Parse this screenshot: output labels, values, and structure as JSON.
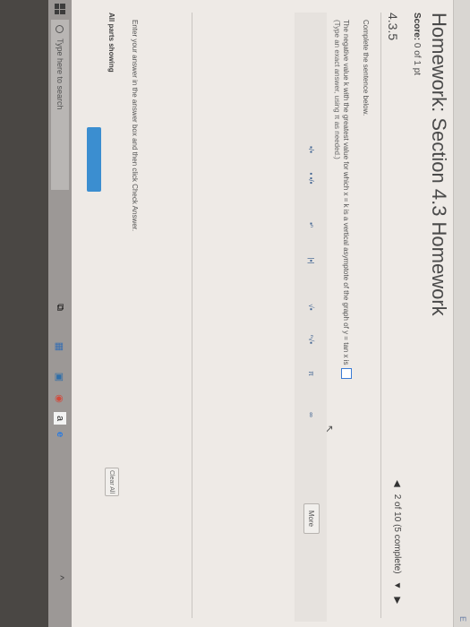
{
  "header": {
    "title": "Homework: Section 4.3 Homework",
    "score_label": "Score:",
    "score_value": "0 of 1 pt",
    "question_number": "4.3.5",
    "nav_status": "2 of 10 (5 complete)"
  },
  "question": {
    "instruction": "Complete the sentence below.",
    "prompt": "The negative value k with the greatest value for which x = k is a vertical asymptote of the graph of y = tan x is",
    "hint": "(Type an exact answer, using π as needed.)"
  },
  "toolbar": {
    "more_label": "More",
    "buttons": [
      "▪/▪",
      "▪ ▪/▪",
      "▪ⁿ",
      "|▪|",
      "√▪",
      "ⁿ√▪",
      "π",
      "∞"
    ]
  },
  "footer": {
    "enter_instruction": "Enter your answer in the answer box and then click Check Answer.",
    "all_parts": "All parts showing",
    "clear_all": "Clear All"
  },
  "taskbar": {
    "search_placeholder": "Type here to search"
  },
  "colors": {
    "accent": "#3b8ed0",
    "answer_box_border": "#3a7bd5"
  }
}
